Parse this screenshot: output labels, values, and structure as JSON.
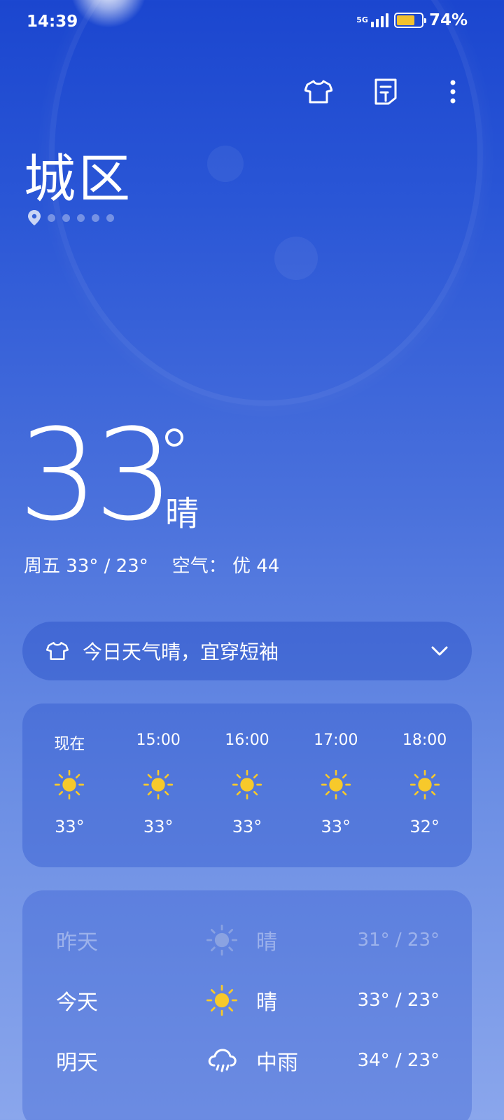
{
  "status_bar": {
    "time": "14:39",
    "network": "5G",
    "battery_percent": "74%",
    "battery_level": 0.74
  },
  "header": {
    "city": "城区",
    "location_pages": 5
  },
  "current": {
    "temperature": "33",
    "condition": "晴",
    "day_range": "周五 33° / 23°",
    "air_quality": "空气： 优 44"
  },
  "advice": {
    "text": "今日天气晴，宜穿短袖",
    "icon": "tshirt-icon"
  },
  "hourly": [
    {
      "time": "现在",
      "icon": "sun-icon",
      "temp": "33°"
    },
    {
      "time": "15:00",
      "icon": "sun-icon",
      "temp": "33°"
    },
    {
      "time": "16:00",
      "icon": "sun-icon",
      "temp": "33°"
    },
    {
      "time": "17:00",
      "icon": "sun-icon",
      "temp": "33°"
    },
    {
      "time": "18:00",
      "icon": "sun-icon",
      "temp": "32°"
    }
  ],
  "daily": [
    {
      "day": "昨天",
      "icon": "sun-icon",
      "condition": "晴",
      "temps": "31° / 23°"
    },
    {
      "day": "今天",
      "icon": "sun-icon",
      "condition": "晴",
      "temps": "33° / 23°"
    },
    {
      "day": "明天",
      "icon": "rain-cloud-icon",
      "condition": "中雨",
      "temps": "34° / 23°"
    }
  ],
  "colors": {
    "sun": "#f7c92b",
    "battery": "#f2c12e"
  }
}
